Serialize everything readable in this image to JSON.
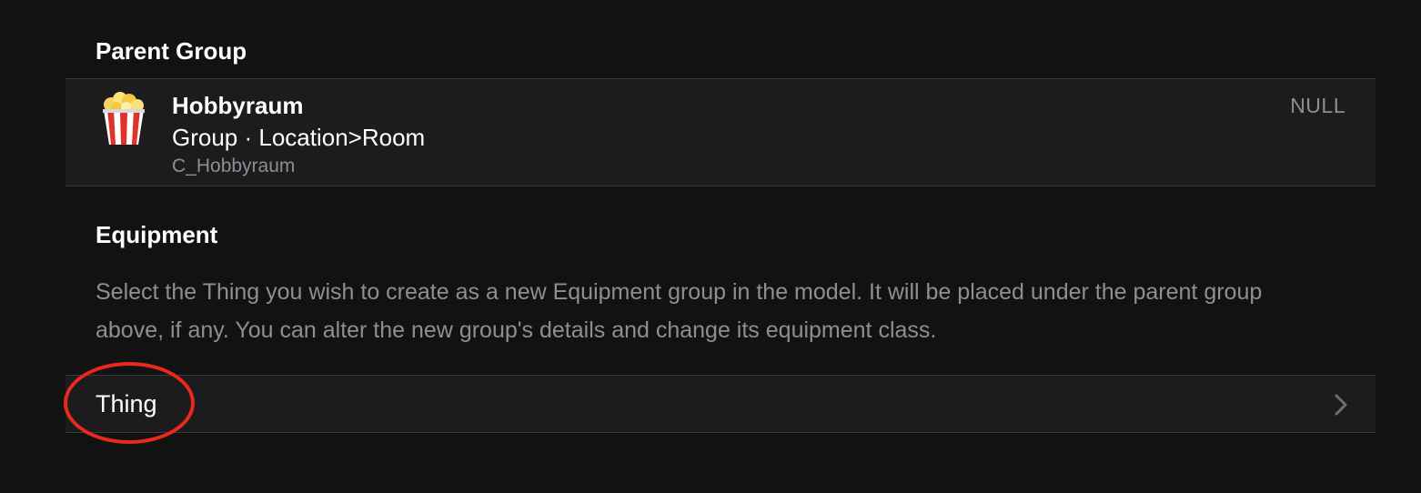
{
  "parent_group": {
    "title": "Parent Group",
    "group": {
      "icon": "popcorn-icon",
      "name": "Hobbyraum",
      "type": "Group · Location>Room",
      "id": "C_Hobbyraum",
      "state": "NULL"
    }
  },
  "equipment": {
    "title": "Equipment",
    "description": "Select the Thing you wish to create as a new Equipment group in the model. It will be placed under the parent group above, if any. You can alter the new group's details and change its equipment class.",
    "thing_row": {
      "label": "Thing",
      "icon": "chevron-right-icon"
    }
  },
  "annotation": {
    "color": "#e8291c",
    "shape": "ellipse",
    "target": "Thing"
  },
  "colors": {
    "background": "#121212",
    "card": "#1c1c1e",
    "secondary_text": "#8e8e93"
  }
}
